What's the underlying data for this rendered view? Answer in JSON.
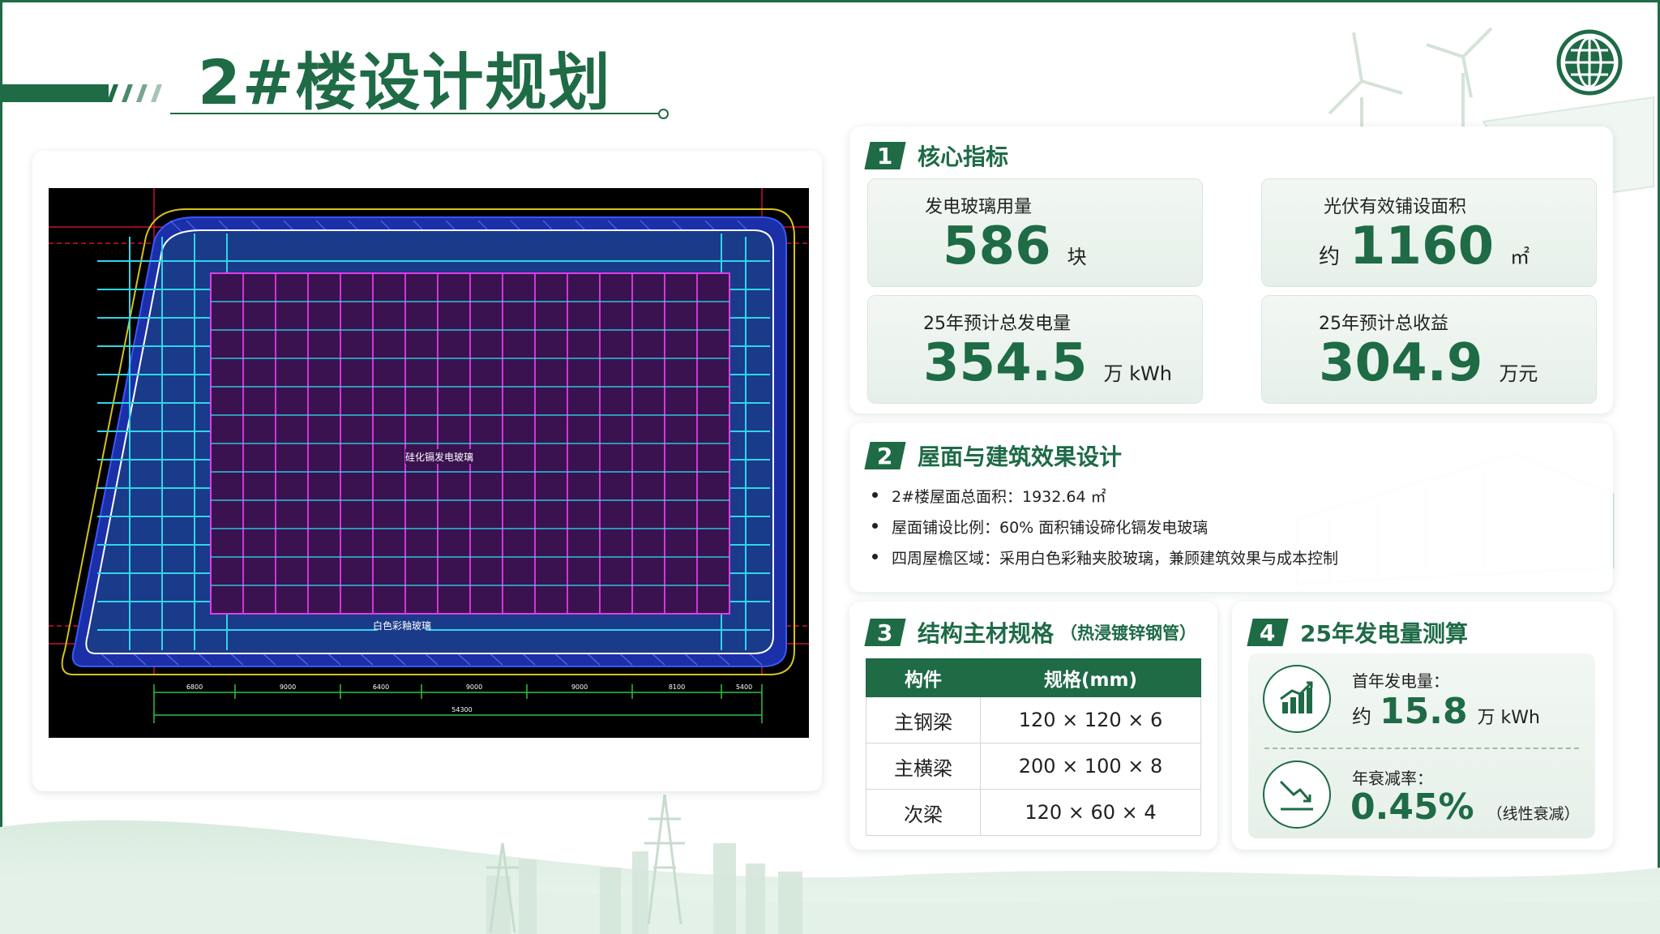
{
  "page": {
    "title": "2#楼设计规划"
  },
  "colors": {
    "brand": "#1e6b46",
    "accent_light": "#e6f0e9"
  },
  "plan": {
    "labels": [
      "硅化镉发电玻璃",
      "白色彩釉玻璃"
    ],
    "dims": [
      "6800",
      "9000",
      "6400",
      "9000",
      "9000",
      "8100",
      "5400",
      "54300"
    ]
  },
  "section1": {
    "num": "1",
    "title": "核心指标",
    "metrics": [
      {
        "label": "发电玻璃用量",
        "prefix": "",
        "value": "586",
        "unit": "块"
      },
      {
        "label": "光伏有效铺设面积",
        "prefix": "约",
        "value": "1160",
        "unit": "㎡"
      },
      {
        "label": "25年预计总发电量",
        "prefix": "",
        "value": "354.5",
        "unit": "万 kWh"
      },
      {
        "label": "25年预计总收益",
        "prefix": "",
        "value": "304.9",
        "unit": "万元"
      }
    ]
  },
  "section2": {
    "num": "2",
    "title": "屋面与建筑效果设计",
    "bullets": [
      "2#楼屋面总面积：1932.64 ㎡",
      "屋面铺设比例：60% 面积铺设碲化镉发电玻璃",
      "四周屋檐区域：采用白色彩釉夹胶玻璃，兼顾建筑效果与成本控制"
    ]
  },
  "section3": {
    "num": "3",
    "title": "结构主材规格",
    "subtitle": "（热浸镀锌钢管）",
    "headers": [
      "构件",
      "规格(mm)"
    ],
    "rows": [
      [
        "主钢梁",
        "120 × 120 × 6"
      ],
      [
        "主横梁",
        "200 × 100 × 8"
      ],
      [
        "次梁",
        "120 × 60 × 4"
      ]
    ]
  },
  "section4": {
    "num": "4",
    "title": "25年发电量测算",
    "first_year": {
      "label": "首年发电量：",
      "prefix": "约",
      "value": "15.8",
      "unit": "万 kWh",
      "icon": "bar-chart-icon"
    },
    "decay": {
      "label": "年衰减率：",
      "value": "0.45%",
      "note": "（线性衰减）",
      "icon": "trend-down-icon"
    }
  }
}
